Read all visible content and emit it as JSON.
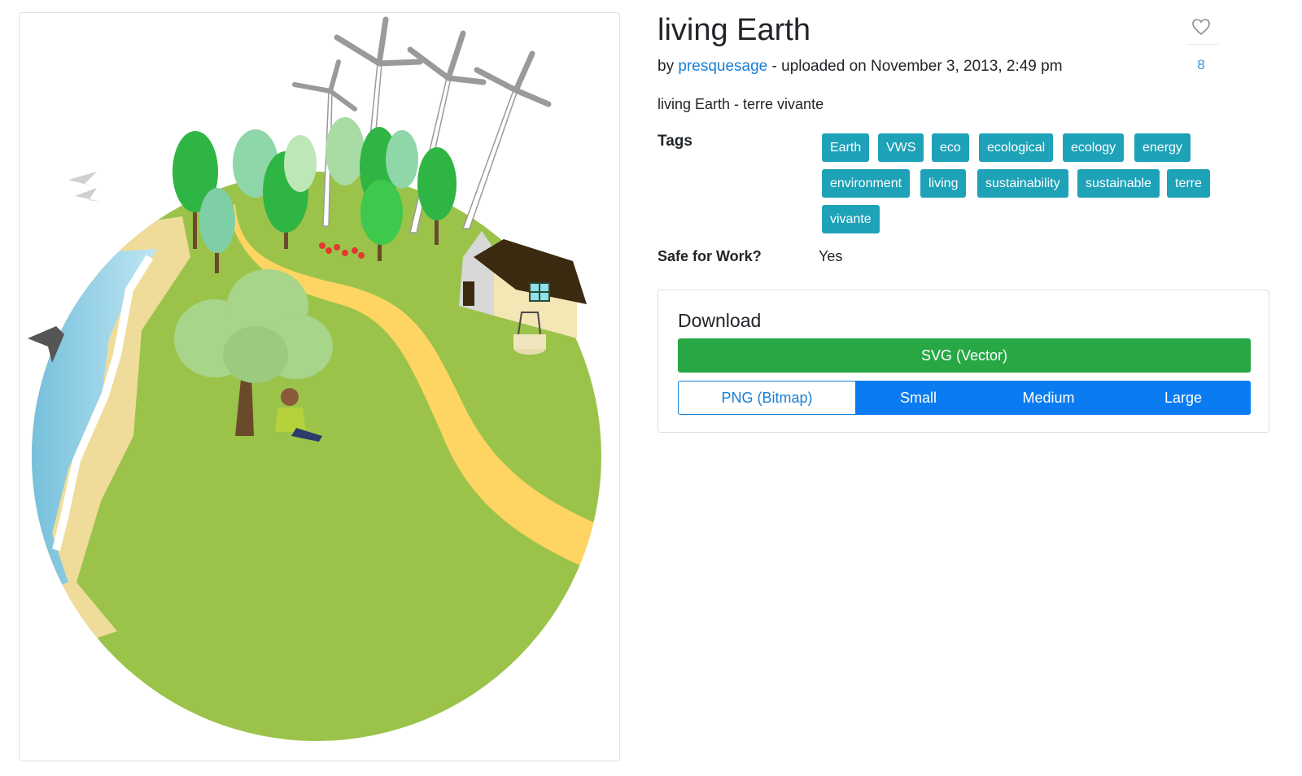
{
  "artwork": {
    "title": "living Earth",
    "by_prefix": "by",
    "author": "presquesage",
    "uploaded": "- uploaded on November 3, 2013, 2:49 pm",
    "description": "living Earth - terre vivante"
  },
  "favorites": {
    "icon": "heart-icon",
    "count": "8"
  },
  "tags": {
    "label": "Tags",
    "items": [
      "Earth",
      "VWS",
      "eco",
      "ecological",
      "ecology",
      "energy",
      "environment",
      "living",
      "sustainability",
      "sustainable",
      "terre",
      "vivante"
    ]
  },
  "sfw": {
    "label": "Safe for Work?",
    "value": "Yes"
  },
  "download": {
    "title": "Download",
    "svg_label": "SVG (Vector)",
    "png_label": "PNG (Bitmap)",
    "sizes": [
      "Small",
      "Medium",
      "Large"
    ]
  },
  "colors": {
    "tag_bg": "#1ea2b8",
    "svg_button": "#28a745",
    "size_button": "#0a7bf0",
    "link": "#1a7fd4",
    "grass": "#9bc34a",
    "path": "#fed562",
    "water": "#8ecfe6"
  }
}
